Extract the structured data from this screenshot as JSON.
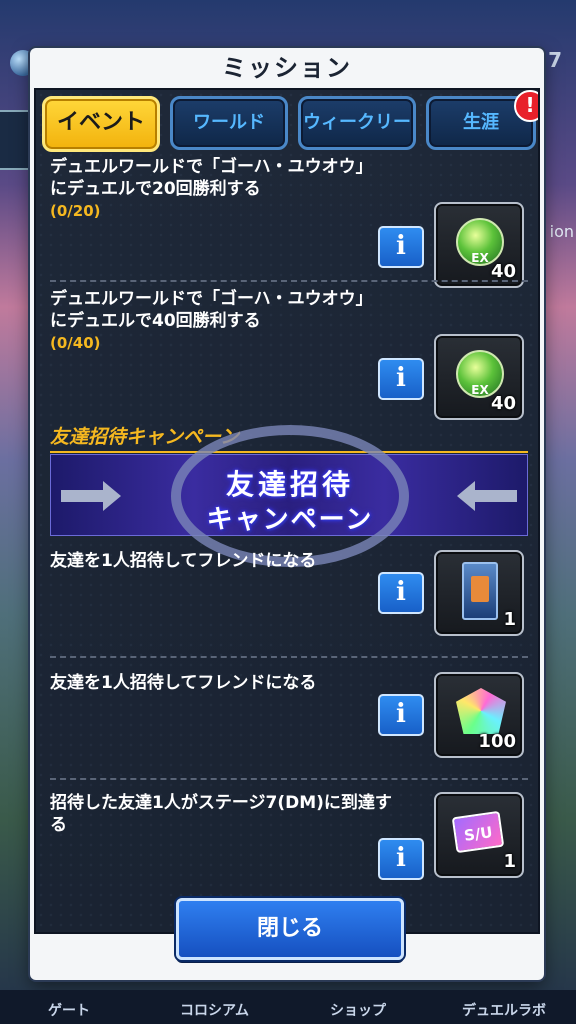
{
  "background": {
    "top_number": "7",
    "right_snippet": "ion"
  },
  "dialog": {
    "title": "ミッション",
    "tabs": [
      {
        "label": "イベント",
        "active": true
      },
      {
        "label": "ワールド",
        "active": false
      },
      {
        "label": "ウィークリー",
        "active": false
      },
      {
        "label": "生涯",
        "active": false
      }
    ],
    "alert_badge": "!",
    "missions": [
      {
        "text_line1": "デュエルワールドで「ゴーハ・ユウオウ」",
        "text_line2": "にデュエルで20回勝利する",
        "progress": "(0/20)",
        "info": "i",
        "reward_icon": "ex-orb-icon",
        "reward_count": "40",
        "reward_label": "EX"
      },
      {
        "text_line1": "デュエルワールドで「ゴーハ・ユウオウ」",
        "text_line2": "にデュエルで40回勝利する",
        "progress": "(0/40)",
        "info": "i",
        "reward_icon": "ex-orb-icon",
        "reward_count": "40",
        "reward_label": "EX"
      }
    ],
    "section": {
      "title": "友達招待キャンペーン",
      "banner_line1": "友達招待",
      "banner_line2": "キャンペーン"
    },
    "campaign_missions": [
      {
        "text_line1": "友達を1人招待してフレンドになる",
        "text_line2": "",
        "info": "i",
        "reward_icon": "card-pack-icon",
        "reward_count": "1"
      },
      {
        "text_line1": "友達を1人招待してフレンドになる",
        "text_line2": "",
        "info": "i",
        "reward_icon": "gem-icon",
        "reward_count": "100"
      },
      {
        "text_line1": "招待した友達1人がステージ7(DM)に到達す",
        "text_line2": "る",
        "info": "i",
        "reward_icon": "su-ticket-icon",
        "reward_count": "1",
        "reward_label": "S/U"
      }
    ],
    "close_label": "閉じる"
  },
  "bottom_nav": {
    "items": [
      "ゲート",
      "コロシアム",
      "ショップ",
      "デュエルラボ"
    ]
  }
}
